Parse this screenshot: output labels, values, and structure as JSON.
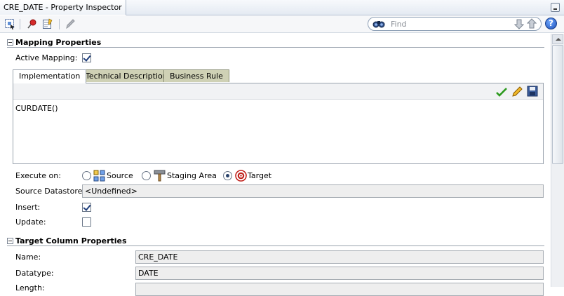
{
  "window": {
    "title": "CRE_DATE - Property Inspector"
  },
  "toolbar": {
    "find_placeholder": "Find",
    "help_label": "?"
  },
  "mapping_properties": {
    "heading": "Mapping Properties",
    "active_mapping_label": "Active Mapping:",
    "active_mapping_checked": true,
    "tabs": [
      {
        "label": "Implementation",
        "active": true
      },
      {
        "label": "Technical Description",
        "active": false
      },
      {
        "label": "Business Rule",
        "active": false
      }
    ],
    "expression": "CURDATE()",
    "execute_on_label": "Execute on:",
    "execute_on_options": [
      {
        "label": "Source",
        "selected": false
      },
      {
        "label": "Staging Area",
        "selected": false
      },
      {
        "label": "Target",
        "selected": true
      }
    ],
    "source_datastore_label": "Source Datastore:",
    "source_datastore_value": "<Undefined>",
    "insert_label": "Insert:",
    "insert_checked": true,
    "update_label": "Update:",
    "update_checked": false
  },
  "target_column_properties": {
    "heading": "Target Column Properties",
    "name_label": "Name:",
    "name_value": "CRE_DATE",
    "datatype_label": "Datatype:",
    "datatype_value": "DATE",
    "length_label": "Length:",
    "length_value": ""
  },
  "colors": {
    "tab_inactive": "#cfd1b5",
    "readonly_field": "#eeeeee",
    "accent": "#1c4fb8"
  }
}
